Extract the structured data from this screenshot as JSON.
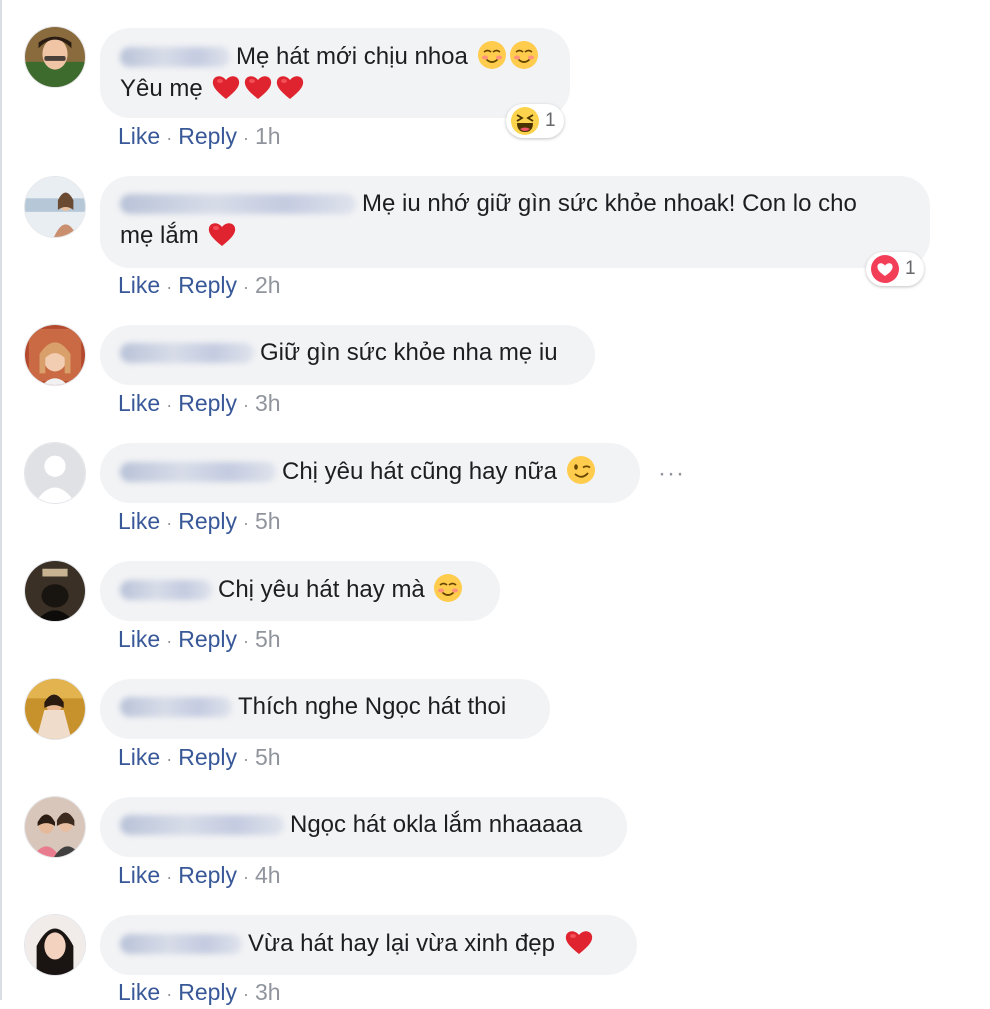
{
  "actions": {
    "like": "Like",
    "reply": "Reply",
    "separator": "·"
  },
  "comments": [
    {
      "line1": "Mẹ hát mới chịu nhoa",
      "line2": "Yêu mẹ",
      "time": "1h",
      "reaction": {
        "type": "haha",
        "count": "1"
      }
    },
    {
      "line1": "Mẹ iu nhớ giữ gìn sức khỏe nhoak! Con lo cho",
      "line2": "mẹ lắm",
      "time": "2h",
      "reaction": {
        "type": "love",
        "count": "1"
      }
    },
    {
      "text": "Giữ gìn sức khỏe nha mẹ iu",
      "time": "3h"
    },
    {
      "text": "Chị yêu hát cũng hay nữa",
      "time": "5h",
      "more": "···"
    },
    {
      "text": "Chị yêu hát hay mà",
      "time": "5h"
    },
    {
      "text": "Thích nghe Ngọc hát thoi",
      "time": "5h"
    },
    {
      "text": "Ngọc hát okla lắm nhaaaaa",
      "time": "4h"
    },
    {
      "text": "Vừa hát hay lại vừa xinh đẹp",
      "time": "3h"
    }
  ],
  "icons": {
    "blush": "smiling-face-icon",
    "heart": "red-heart-icon",
    "wink": "winking-face-icon",
    "haha": "laughing-reaction-icon",
    "love": "love-reaction-icon"
  },
  "colors": {
    "link": "#385898",
    "bubble": "#f2f3f5",
    "meta": "#90949c",
    "heart": "#e0242f"
  }
}
